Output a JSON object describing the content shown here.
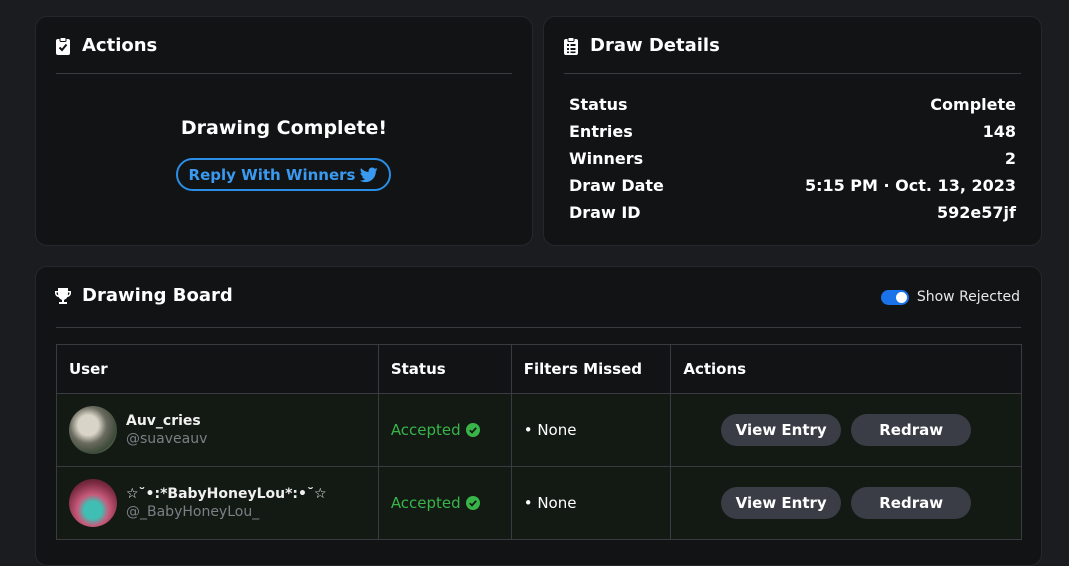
{
  "actions": {
    "title": "Actions",
    "message": "Drawing Complete!",
    "reply_button": "Reply With Winners"
  },
  "details": {
    "title": "Draw Details",
    "rows": [
      {
        "label": "Status",
        "value": "Complete"
      },
      {
        "label": "Entries",
        "value": "148"
      },
      {
        "label": "Winners",
        "value": "2"
      },
      {
        "label": "Draw Date",
        "value": "5:15 PM · Oct. 13, 2023"
      },
      {
        "label": "Draw ID",
        "value": "592e57jf"
      }
    ]
  },
  "board": {
    "title": "Drawing Board",
    "toggle_label": "Show Rejected",
    "toggle_on": true,
    "columns": [
      "User",
      "Status",
      "Filters Missed",
      "Actions"
    ],
    "rows": [
      {
        "name": "Auv_cries",
        "handle": "@suaveauv",
        "status": "Accepted",
        "filters": "• None",
        "view_label": "View Entry",
        "redraw_label": "Redraw"
      },
      {
        "name": "☆˘•:*BabyHoneyLou*:•˘☆",
        "handle": "@_BabyHoneyLou_",
        "status": "Accepted",
        "filters": "• None",
        "view_label": "View Entry",
        "redraw_label": "Redraw"
      }
    ]
  },
  "colors": {
    "accent": "#2a8ee6",
    "accepted": "#38b449",
    "toggle": "#1a73e8"
  },
  "icons": {
    "actions": "clipboard-check-icon",
    "details": "clipboard-list-icon",
    "board": "trophy-icon",
    "reply": "twitter-icon",
    "accepted": "check-circle-icon"
  }
}
